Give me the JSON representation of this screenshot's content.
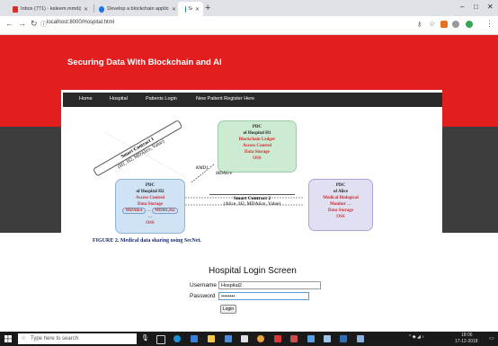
{
  "browser": {
    "tabs": [
      {
        "title": "Inbox (771) - kaleem.mmd@gm",
        "active": false
      },
      {
        "title": "Develop a blockchain applicatio",
        "active": false
      },
      {
        "title": "Securing Data With Blockchain a",
        "active": true
      }
    ],
    "new_tab_label": "+",
    "url": "localhost:8000/Hospital.html",
    "window_controls": {
      "minimize": "–",
      "maximize": "□",
      "close": "✕"
    }
  },
  "site": {
    "title": "Securing Data With Blockchain and AI",
    "nav": [
      "Home",
      "Hospital",
      "Patients Login",
      "New Patient Register Here"
    ]
  },
  "figure": {
    "caption": "FIGURE 2.  Medical data sharing using SecNet.",
    "top_box": {
      "title": "PDC",
      "subtitle": "of Hospital H1",
      "rows": [
        "Blockchain Ledger",
        "Access Control",
        "Data Storage",
        "OSS"
      ]
    },
    "left_box": {
      "title": "PDC",
      "subtitle": "of Hospital H2",
      "rows": [
        "Access Control",
        "Data Storage",
        "MDAlice",
        "…",
        "MDH1,H2",
        "…",
        "OSS"
      ]
    },
    "right_box": {
      "title": "PDC",
      "subtitle": "of Alice",
      "rows": [
        "Medical",
        "Biological",
        "Monitor",
        "…",
        "Data Storage",
        "OSS"
      ]
    },
    "contract1": {
      "title": "Smart Contract 1",
      "body": "(H1, H2, MDAlice, Value)"
    },
    "contract2": {
      "title": "Smart Contract 2",
      "body": "(Alice, H2, MDAlice, Value)"
    },
    "labels": {
      "k": "KMD1",
      "md": "MDAlice"
    }
  },
  "login": {
    "title": "Hospital Login Screen",
    "username_label": "Username",
    "username_value": "Hospital2",
    "password_label": "Password",
    "password_value": "••••••••",
    "button_label": "Login"
  },
  "taskbar": {
    "search_placeholder": "Type here to search",
    "time": "18:06",
    "date": "17-12-2018"
  },
  "colors": {
    "brand_red": "#e31e1e",
    "dark_band": "#3d3d3d",
    "navbar": "#2a2a2a"
  }
}
